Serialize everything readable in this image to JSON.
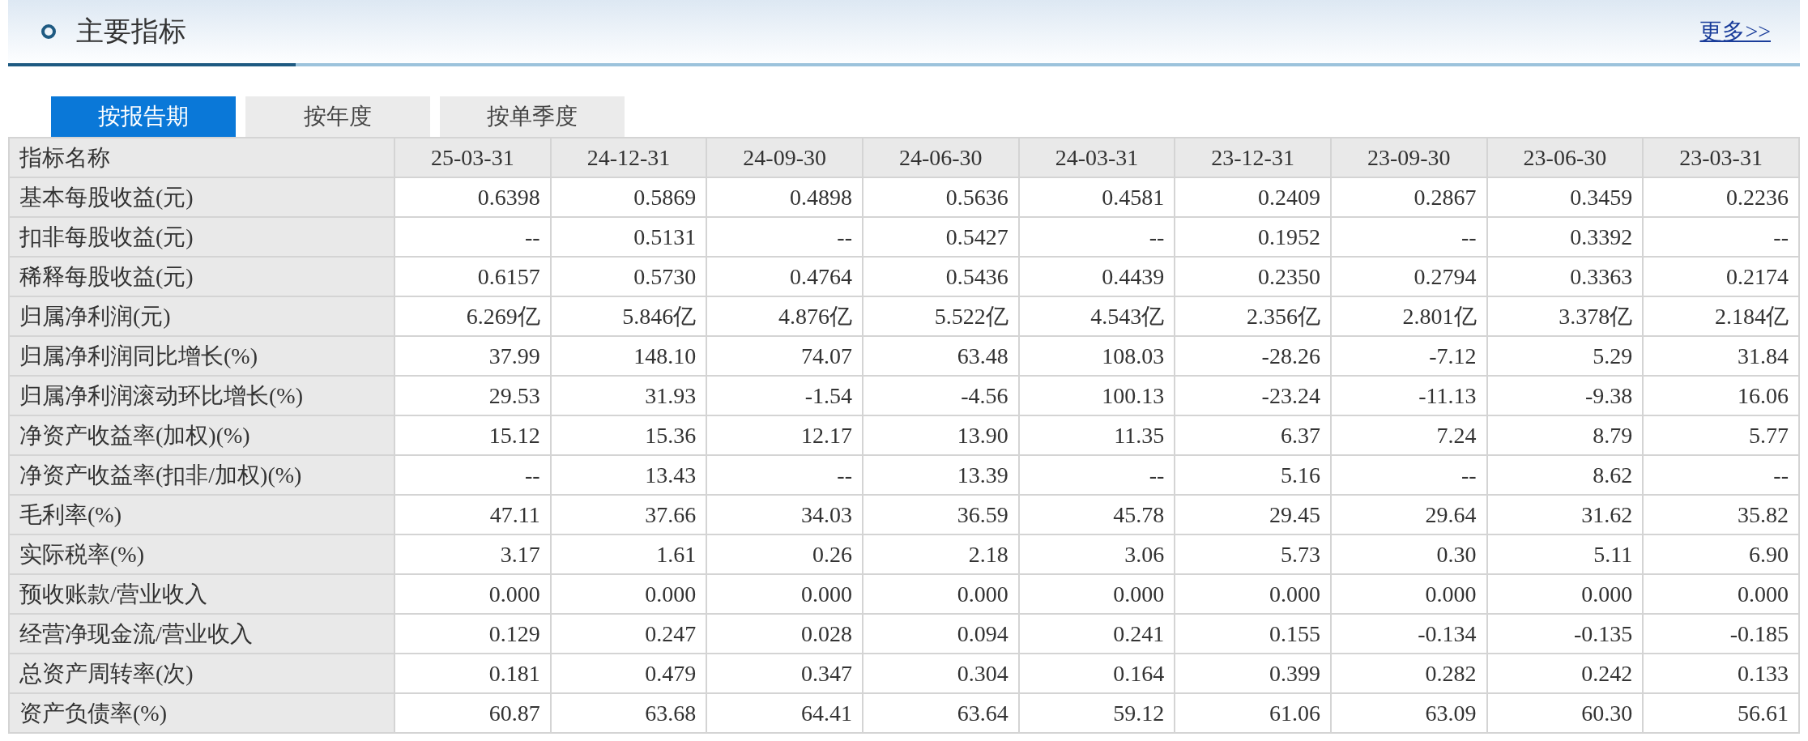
{
  "header": {
    "title": "主要指标",
    "more_link": "更多>>"
  },
  "tabs": [
    {
      "label": "按报告期",
      "selected": true
    },
    {
      "label": "按年度",
      "selected": false
    },
    {
      "label": "按单季度",
      "selected": false
    }
  ],
  "table": {
    "columns": [
      "指标名称",
      "25-03-31",
      "24-12-31",
      "24-09-30",
      "24-06-30",
      "24-03-31",
      "23-12-31",
      "23-09-30",
      "23-06-30",
      "23-03-31"
    ],
    "rows": [
      {
        "label": "基本每股收益(元)",
        "values": [
          "0.6398",
          "0.5869",
          "0.4898",
          "0.5636",
          "0.4581",
          "0.2409",
          "0.2867",
          "0.3459",
          "0.2236"
        ]
      },
      {
        "label": "扣非每股收益(元)",
        "values": [
          "--",
          "0.5131",
          "--",
          "0.5427",
          "--",
          "0.1952",
          "--",
          "0.3392",
          "--"
        ]
      },
      {
        "label": "稀释每股收益(元)",
        "values": [
          "0.6157",
          "0.5730",
          "0.4764",
          "0.5436",
          "0.4439",
          "0.2350",
          "0.2794",
          "0.3363",
          "0.2174"
        ]
      },
      {
        "label": "归属净利润(元)",
        "values": [
          "6.269亿",
          "5.846亿",
          "4.876亿",
          "5.522亿",
          "4.543亿",
          "2.356亿",
          "2.801亿",
          "3.378亿",
          "2.184亿"
        ]
      },
      {
        "label": "归属净利润同比增长(%)",
        "values": [
          "37.99",
          "148.10",
          "74.07",
          "63.48",
          "108.03",
          "-28.26",
          "-7.12",
          "5.29",
          "31.84"
        ]
      },
      {
        "label": "归属净利润滚动环比增长(%)",
        "values": [
          "29.53",
          "31.93",
          "-1.54",
          "-4.56",
          "100.13",
          "-23.24",
          "-11.13",
          "-9.38",
          "16.06"
        ]
      },
      {
        "label": "净资产收益率(加权)(%)",
        "values": [
          "15.12",
          "15.36",
          "12.17",
          "13.90",
          "11.35",
          "6.37",
          "7.24",
          "8.79",
          "5.77"
        ]
      },
      {
        "label": "净资产收益率(扣非/加权)(%)",
        "values": [
          "--",
          "13.43",
          "--",
          "13.39",
          "--",
          "5.16",
          "--",
          "8.62",
          "--"
        ]
      },
      {
        "label": "毛利率(%)",
        "values": [
          "47.11",
          "37.66",
          "34.03",
          "36.59",
          "45.78",
          "29.45",
          "29.64",
          "31.62",
          "35.82"
        ]
      },
      {
        "label": "实际税率(%)",
        "values": [
          "3.17",
          "1.61",
          "0.26",
          "2.18",
          "3.06",
          "5.73",
          "0.30",
          "5.11",
          "6.90"
        ]
      },
      {
        "label": "预收账款/营业收入",
        "values": [
          "0.000",
          "0.000",
          "0.000",
          "0.000",
          "0.000",
          "0.000",
          "0.000",
          "0.000",
          "0.000"
        ]
      },
      {
        "label": "经营净现金流/营业收入",
        "values": [
          "0.129",
          "0.247",
          "0.028",
          "0.094",
          "0.241",
          "0.155",
          "-0.134",
          "-0.135",
          "-0.185"
        ]
      },
      {
        "label": "总资产周转率(次)",
        "values": [
          "0.181",
          "0.479",
          "0.347",
          "0.304",
          "0.164",
          "0.399",
          "0.282",
          "0.242",
          "0.133"
        ]
      },
      {
        "label": "资产负债率(%)",
        "values": [
          "60.87",
          "63.68",
          "64.41",
          "63.64",
          "59.12",
          "61.06",
          "63.09",
          "60.30",
          "56.61"
        ]
      }
    ]
  }
}
